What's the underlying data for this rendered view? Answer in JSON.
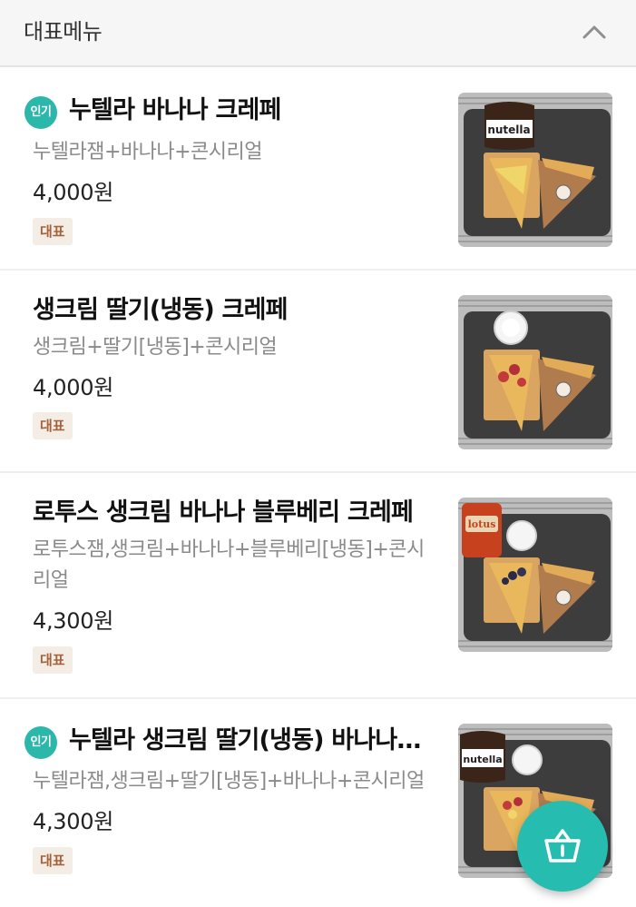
{
  "header": {
    "title": "대표메뉴",
    "collapse_icon": "chevron-up-icon"
  },
  "badges": {
    "popular": "인기",
    "signature": "대표"
  },
  "items": [
    {
      "name": "누텔라 바나나 크레페",
      "description": "누텔라잼+바나나+콘시리얼",
      "price": "4,000원",
      "popular": true,
      "jar": "nutella",
      "jar_text": "nutella",
      "thumb_note": "스티커 라벨"
    },
    {
      "name": "생크림 딸기(냉동) 크레페",
      "description": "생크림+딸기[냉동]+콘시리얼",
      "price": "4,000원",
      "popular": false,
      "jar": "cream"
    },
    {
      "name": "로투스 생크림 바나나 블루베리 크레페",
      "description": "로투스잼,생크림+바나나+블루베리[냉동]+콘시리얼",
      "price": "4,300원",
      "popular": false,
      "jar": "lotus",
      "jar_text": "lotus"
    },
    {
      "name": "누텔라 생크림 딸기(냉동) 바나나…",
      "description": "누텔라잼,생크림+딸기[냉동]+바나나+콘시리얼",
      "price": "4,300원",
      "popular": true,
      "jar": "nutella",
      "jar_text": "nutella"
    }
  ],
  "cart": {
    "icon": "basket-icon"
  },
  "colors": {
    "accent": "#27bcb0",
    "tag_text": "#a4623a",
    "tag_bg": "#f3ede5"
  }
}
